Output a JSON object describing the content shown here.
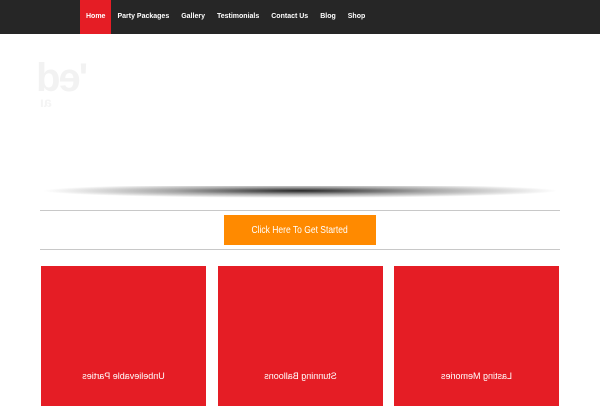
{
  "nav": {
    "items": [
      {
        "label": "Home",
        "active": true
      },
      {
        "label": "Party Packages",
        "active": false
      },
      {
        "label": "Gallery",
        "active": false
      },
      {
        "label": "Testimonials",
        "active": false
      },
      {
        "label": "Contact Us",
        "active": false
      },
      {
        "label": "Blog",
        "active": false
      },
      {
        "label": "Shop",
        "active": false
      }
    ]
  },
  "hero": {
    "faint_text": "'ed",
    "faint_text_2": "aı"
  },
  "cta": {
    "label": "Click Here To Get Started"
  },
  "cards": [
    {
      "label": "Unbelievable Parties"
    },
    {
      "label": "Stunning Balloons"
    },
    {
      "label": "Lasting Memories"
    }
  ],
  "colors": {
    "topbar": "#262626",
    "accent_red": "#e51d25",
    "cta_orange": "#ff8a00"
  }
}
